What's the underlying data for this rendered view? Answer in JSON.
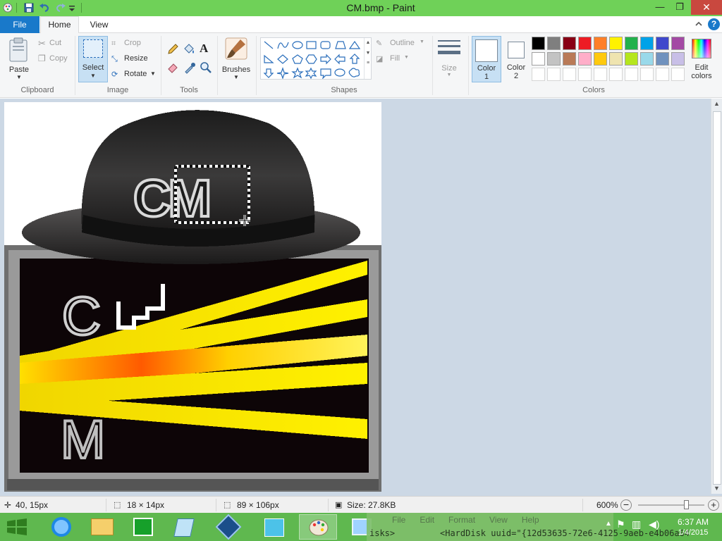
{
  "window": {
    "title": "CM.bmp - Paint",
    "minimize_glyph": "—",
    "restore_glyph": "❐",
    "close_glyph": "✕"
  },
  "tabs": {
    "file": "File",
    "home": "Home",
    "view": "View"
  },
  "help_glyph": "?",
  "clipboard": {
    "paste": "Paste",
    "cut": "Cut",
    "copy": "Copy",
    "group": "Clipboard"
  },
  "image": {
    "select": "Select",
    "crop": "Crop",
    "resize": "Resize",
    "rotate": "Rotate",
    "group": "Image"
  },
  "tools": {
    "group": "Tools",
    "text_glyph": "A"
  },
  "brushes": {
    "label": "Brushes"
  },
  "shapes": {
    "outline": "Outline",
    "fill": "Fill",
    "group": "Shapes"
  },
  "size": {
    "label": "Size"
  },
  "color1": {
    "label": "Color",
    "number": "1"
  },
  "color2": {
    "label": "Color",
    "number": "2"
  },
  "colors": {
    "group": "Colors",
    "edit_label": "Edit",
    "edit_label2": "colors",
    "row1": [
      "#000000",
      "#7f7f7f",
      "#880015",
      "#ed1c24",
      "#ff7f27",
      "#fff200",
      "#22b14c",
      "#00a2e8",
      "#3f48cc",
      "#a349a4"
    ],
    "row2": [
      "#ffffff",
      "#c3c3c3",
      "#b97a57",
      "#ffaec9",
      "#ffc90e",
      "#efe4b0",
      "#b5e61d",
      "#99d9ea",
      "#7092be",
      "#c8bfe7"
    ]
  },
  "status": {
    "cursor_pos": "40, 15px",
    "selection_size": "18 × 14px",
    "image_size": "89 × 106px",
    "file_size": "Size: 27.8KB",
    "zoom": "600%",
    "zoom_level": 0.72
  },
  "taskbar": {
    "time": "6:37 AM",
    "date": "1/4/2015",
    "overlay_menu": [
      "File",
      "Edit",
      "Format",
      "View",
      "Help"
    ],
    "overlay_text": "<HardDisk uuid=\"{12d53635-72e6-4125-9aeb-e4b06a64",
    "overlay_left": "isks>"
  },
  "canvas_text": {
    "hat_letters": "CM",
    "screen_top": "C",
    "screen_bottom": "M"
  }
}
